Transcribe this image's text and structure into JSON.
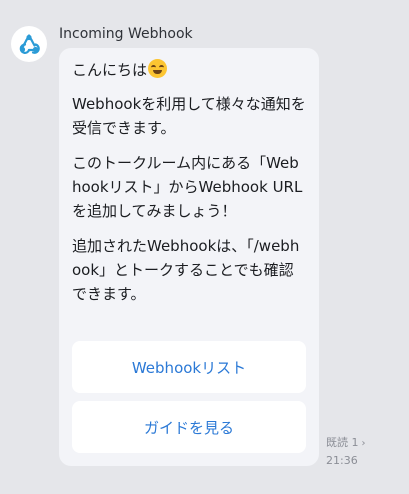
{
  "message": {
    "sender_name": "Incoming Webhook",
    "avatar_icon": "webhook-icon",
    "greeting": "こんにちは",
    "greeting_emoji": "grinning-face-emoji",
    "paragraphs": [
      "Webhookを利用して様々な通知を受信できます。",
      "このトークルーム内にある「Webhookリスト」からWebhook URLを追加してみましょう！",
      "追加されたWebhookは、「/webhook」とトークすることでも確認できます。"
    ],
    "buttons": {
      "webhook_list": "Webhookリスト",
      "guide": "ガイドを見る"
    },
    "read_receipt": "既読 1",
    "read_receipt_icon": "chevron-right-icon",
    "timestamp": "21:36"
  },
  "colors": {
    "background": "#e5e6ea",
    "bubble": "#f3f4f8",
    "button_text": "#2b79d6",
    "avatar_icon": "#2b9bd6"
  }
}
